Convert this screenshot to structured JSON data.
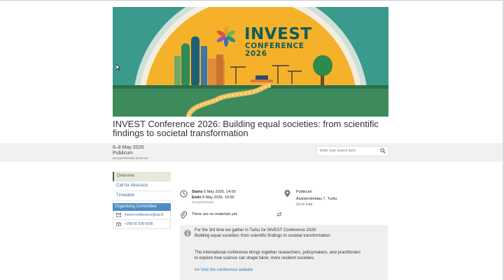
{
  "banner": {
    "title": "INVEST",
    "subtitle": "CONFERENCE 2026"
  },
  "event": {
    "title": "INVEST Conference 2026: Building equal societies: from scientific findings to societal transformation",
    "date": "6–8 May 2026",
    "venue": "Publicum",
    "timezone": "Europe/Helsinki timezone"
  },
  "search": {
    "placeholder": "Enter your search term"
  },
  "sidebar": {
    "items": [
      {
        "label": "Overview",
        "active": true
      },
      {
        "label": "Call for Abstracts",
        "active": false
      },
      {
        "label": "Timetable",
        "active": false
      }
    ],
    "committee_header": "Organising Committee",
    "email": "invest-conference@utu.fi",
    "phone": "+358 50 528 6008"
  },
  "details": {
    "starts_label": "Starts",
    "starts_value": "6 May 2026, 14:00",
    "ends_label": "Ends",
    "ends_value": "8 May 2026, 16:00",
    "timezone": "Europe/Helsinki",
    "place": "Publicum",
    "address": "Assistentinkatu 7, Turku",
    "map_link": "Go to map",
    "materials": "There are no materials yet."
  },
  "description": {
    "paragraph1_line1": "For the 3rd time we gather in Turku for INVEST Conference 2026:",
    "paragraph1_line2": "Building equal societies: from scientific findings to societal transformation",
    "paragraph2_line1": "The international conference brings together researchers, policymakers, and practitioners",
    "paragraph2_line2": "to explore how science can shape fairer, more resilient societies.",
    "link_prefix": ">>",
    "link_text": "Visit the conference website"
  },
  "colors": {
    "accent_link": "#2f7fc1",
    "sidebar_header": "#4d8cc6",
    "banner_sun": "#f6b12a",
    "banner_teal": "#2f8f82"
  }
}
